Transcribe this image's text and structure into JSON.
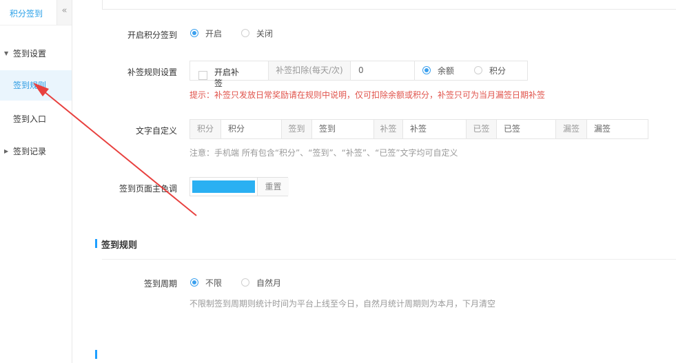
{
  "sidebar": {
    "title": "积分签到",
    "collapse_glyph": "«",
    "group_settings": "签到设置",
    "items": [
      {
        "label": "签到规则"
      },
      {
        "label": "签到入口"
      }
    ],
    "group_records": "签到记录"
  },
  "form": {
    "enable": {
      "label": "开启积分签到",
      "options": [
        "开启",
        "关闭"
      ],
      "selected": "开启"
    },
    "makeup": {
      "label": "补签规则设置",
      "checkbox_label_line1": "开启补",
      "checkbox_label_line2": "签",
      "checked": false,
      "deduct_label": "补签扣除(每天/次)",
      "deduct_value": "0",
      "deduct_options": [
        "余额",
        "积分"
      ],
      "deduct_selected": "余额",
      "tip": "提示：补签只发放日常奖励请在规则中说明，仅可扣除余额或积分，补签只可为当月漏签日期补签"
    },
    "text_custom": {
      "label": "文字自定义",
      "pairs": [
        {
          "addon": "积分",
          "value": "积分"
        },
        {
          "addon": "签到",
          "value": "签到"
        },
        {
          "addon": "补签",
          "value": "补签"
        },
        {
          "addon": "已签",
          "value": "已签"
        },
        {
          "addon": "漏签",
          "value": "漏签"
        }
      ],
      "note": "注意：手机端 所有包含“积分”、“签到”、“补签”、“已签”文字均可自定义"
    },
    "theme_color": {
      "label": "签到页面主色调",
      "color": "#2ab0f2",
      "reset_label": "重置"
    }
  },
  "section_rules": {
    "title": "签到规则",
    "cycle": {
      "label": "签到周期",
      "options": [
        "不限",
        "自然月"
      ],
      "selected": "不限",
      "note": "不限制签到周期则统计时间为平台上线至今日，自然月统计周期则为本月，下月清空"
    }
  },
  "colors": {
    "accent": "#1e9fff",
    "tip_red": "#e0534b",
    "annotation_red": "#e8403e"
  }
}
